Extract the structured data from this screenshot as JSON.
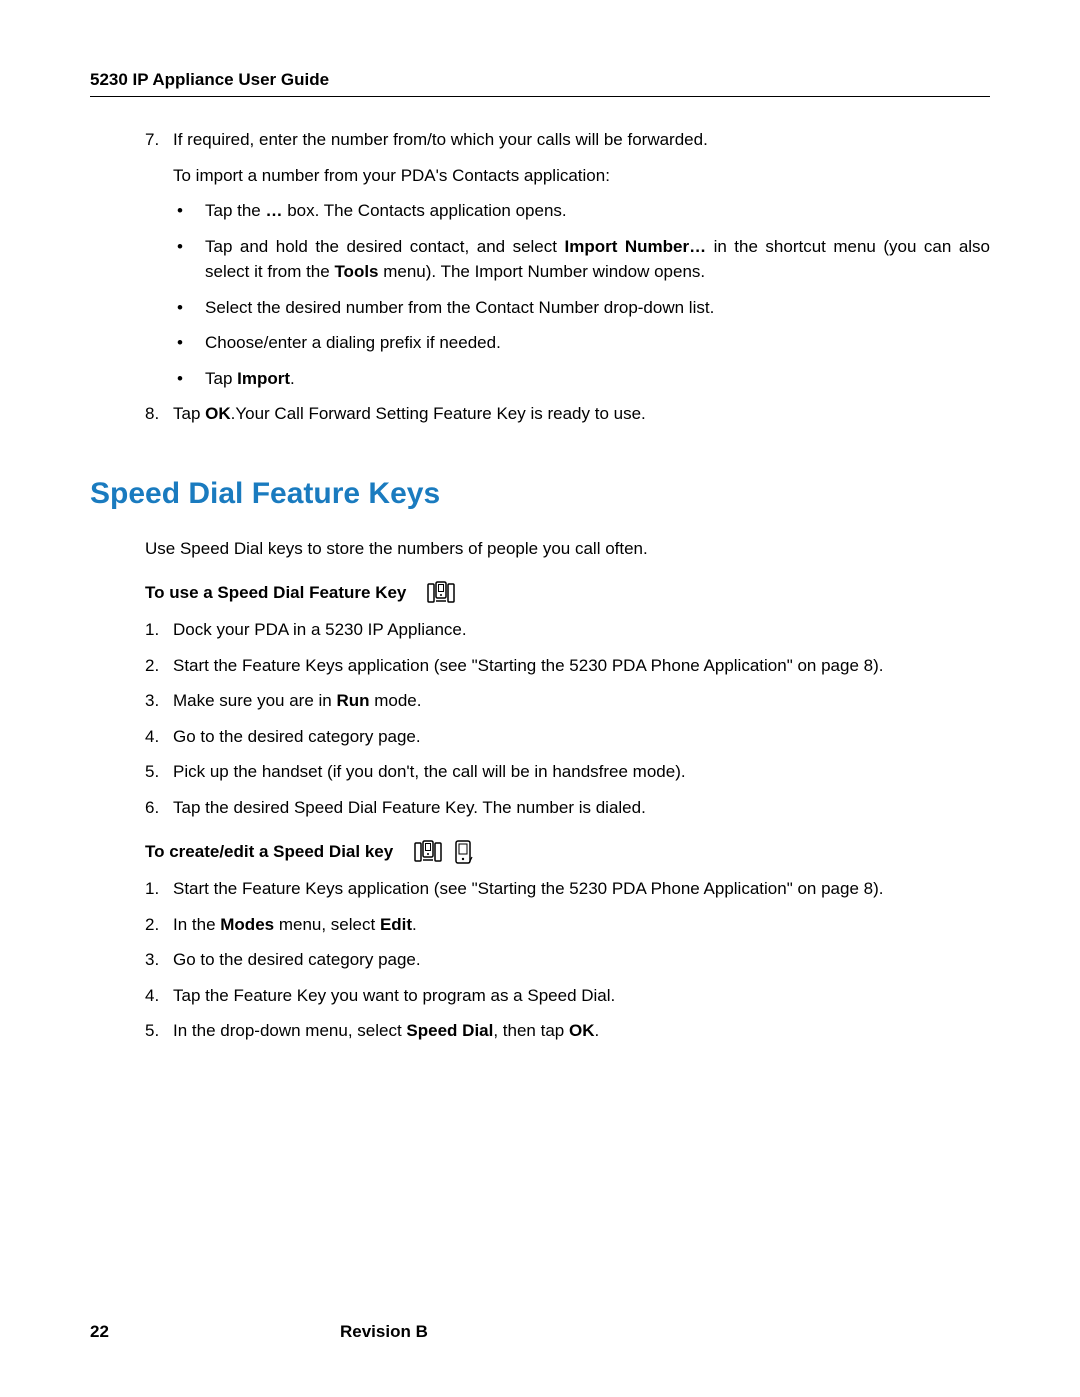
{
  "header": {
    "title": "5230 IP Appliance User Guide"
  },
  "topList": {
    "item7_num": "7.",
    "item7_text": "If required, enter the number from/to which your calls will be forwarded.",
    "item7_sub": "To import a number from your PDA's Contacts application:",
    "bullets": {
      "b1_pre": "Tap the ",
      "b1_bold": "…",
      "b1_post": " box. The Contacts application opens.",
      "b2_pre": "Tap and hold the desired contact, and select ",
      "b2_bold1": "Import Number…",
      "b2_mid": " in the shortcut menu (you can also select it from the ",
      "b2_bold2": "Tools",
      "b2_post": " menu). The Import Number window opens.",
      "b3": "Select the desired number from the Contact Number drop-down list.",
      "b4": "Choose/enter a dialing prefix if needed.",
      "b5_pre": "Tap ",
      "b5_bold": "Import",
      "b5_post": "."
    },
    "item8_num": "8.",
    "item8_pre": "Tap ",
    "item8_bold": "OK",
    "item8_post": ".Your Call Forward Setting Feature Key is ready to use."
  },
  "section": {
    "heading": "Speed Dial Feature Keys",
    "intro": "Use Speed Dial keys to store the numbers of people you call often.",
    "sub1_title": "To use a Speed Dial Feature Key",
    "sub1_steps": {
      "s1_num": "1.",
      "s1": "Dock your PDA in a 5230 IP Appliance.",
      "s2_num": "2.",
      "s2": "Start the Feature Keys application (see \"Starting the 5230 PDA Phone Application\" on page 8).",
      "s3_num": "3.",
      "s3_pre": "Make sure you are in ",
      "s3_bold": "Run",
      "s3_post": " mode.",
      "s4_num": "4.",
      "s4": "Go to the desired category page.",
      "s5_num": "5.",
      "s5": "Pick up the handset (if you don't, the call will be in handsfree mode).",
      "s6_num": "6.",
      "s6": "Tap the desired Speed Dial Feature Key. The number is dialed."
    },
    "sub2_title": "To create/edit a Speed Dial key",
    "sub2_steps": {
      "s1_num": "1.",
      "s1": "Start the Feature Keys application (see \"Starting the 5230 PDA Phone Application\" on page 8).",
      "s2_num": "2.",
      "s2_pre": "In the ",
      "s2_bold1": "Modes",
      "s2_mid": " menu, select ",
      "s2_bold2": "Edit",
      "s2_post": ".",
      "s3_num": "3.",
      "s3": "Go to the desired category page.",
      "s4_num": "4.",
      "s4": "Tap the Feature Key you want to program as a Speed Dial.",
      "s5_num": "5.",
      "s5_pre": "In the drop-down menu, select ",
      "s5_bold1": "Speed Dial",
      "s5_mid": ", then tap ",
      "s5_bold2": "OK",
      "s5_post": "."
    }
  },
  "footer": {
    "page": "22",
    "revision": "Revision B"
  }
}
